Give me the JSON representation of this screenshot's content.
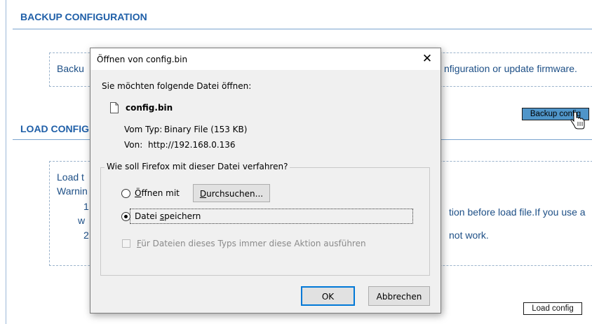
{
  "page": {
    "backup_section": {
      "title": "BACKUP CONFIGURATION",
      "description_start": "Backu",
      "description_end": "nfiguration or update firmware.",
      "button_label": "Backup config"
    },
    "load_section": {
      "title": "LOAD CONFIGURATION",
      "title_visible": "LOAD CONFIG",
      "line1": "Load t",
      "line2": "Warnin",
      "item1_num": "1",
      "item1_cont": "w",
      "item1_end": "tion before load file.If you use a",
      "item2_num": "2",
      "item2_end": "not work.",
      "button_label": "Load config"
    }
  },
  "dialog": {
    "title": "Öffnen von config.bin",
    "close_symbol": "✕",
    "prompt": "Sie möchten folgende Datei öffnen:",
    "file_name": "config.bin",
    "type_label": "Vom Typ:",
    "type_value": "Binary File (153 KB)",
    "from_label": "Von:",
    "from_value": "http://192.168.0.136",
    "group_label": "Wie soll Firefox mit dieser Datei verfahren?",
    "open_with_label": "Öffnen mit",
    "browse_button": "Durchsuchen...",
    "save_file_label": "Datei speichern",
    "always_label": "Für Dateien dieses Typs immer diese Aktion ausführen",
    "ok_button": "OK",
    "cancel_button": "Abbrechen",
    "selected_option": "save_file",
    "always_checked": false
  },
  "colors": {
    "section_title": "#1f5fa8",
    "backup_button_bg": "#4f95c9",
    "ok_button_border": "#0078d7"
  }
}
